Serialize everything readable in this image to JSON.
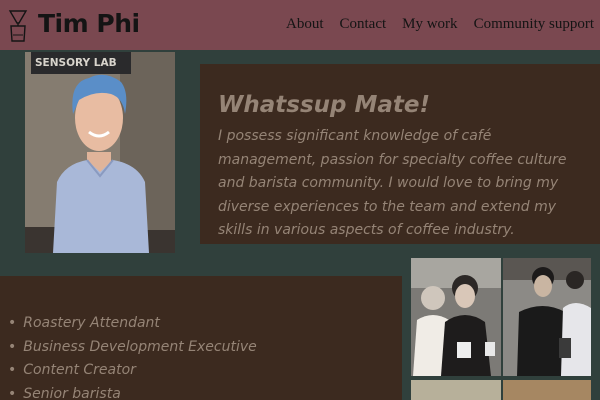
{
  "brand": {
    "name": "Tim Phi",
    "icon": "coffee-dripper-icon"
  },
  "nav": {
    "items": [
      {
        "label": "About"
      },
      {
        "label": "Contact"
      },
      {
        "label": "My work"
      },
      {
        "label": "Community support"
      }
    ]
  },
  "profile": {
    "sign_text": "SENSORY LAB"
  },
  "hero": {
    "title": "Whatssup Mate!",
    "text": "I possess significant knowledge of café management, passion for specialty coffee culture and barista community. I would love to bring my diverse experiences to the team and extend my skills in various aspects of coffee industry."
  },
  "roles": [
    "Roastery Attendant",
    "Business Development Executive",
    "Content Creator",
    "Senior barista"
  ],
  "colors": {
    "navbar": "#7a4850",
    "background": "#30403c",
    "card": "#3c2a1f",
    "card_text": "#958476"
  }
}
